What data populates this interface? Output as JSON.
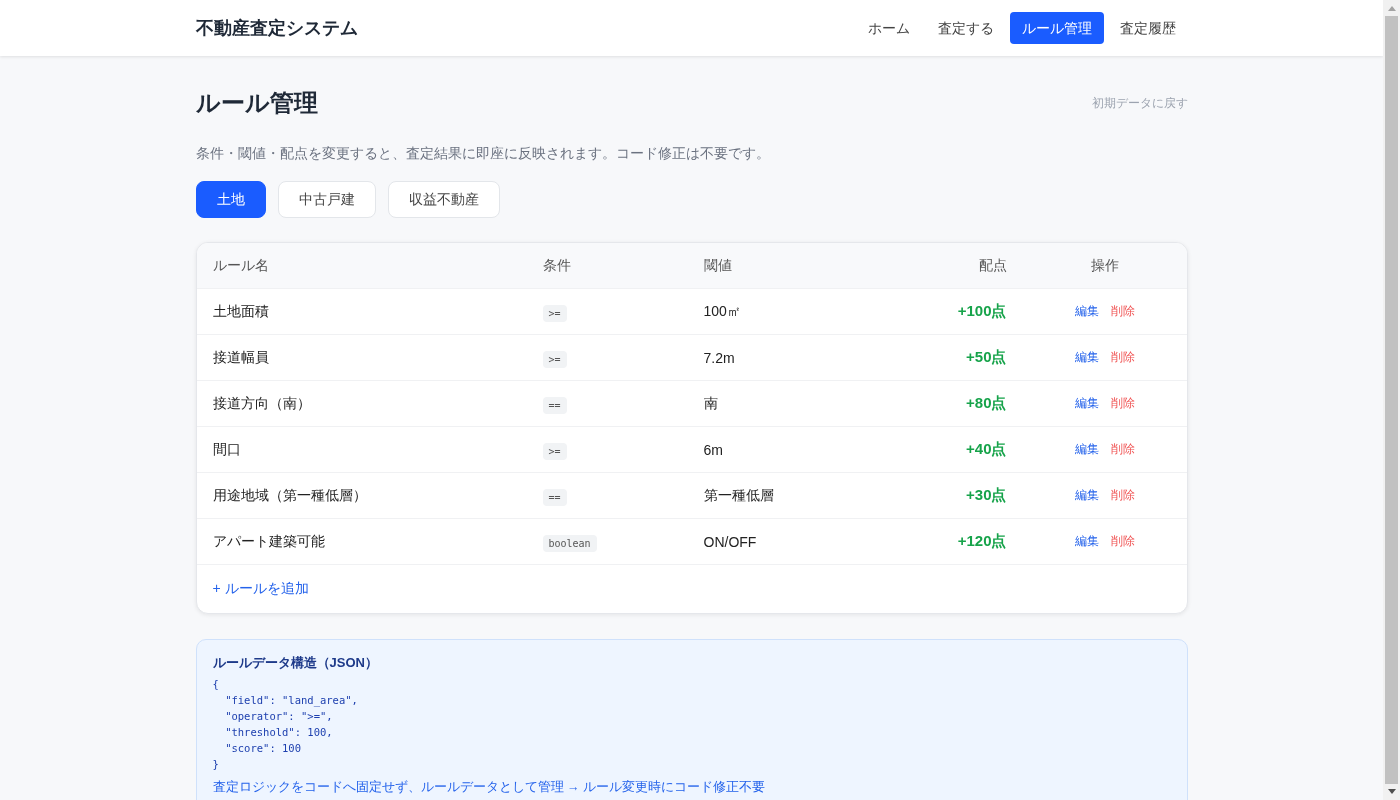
{
  "header": {
    "logo": "不動産査定システム",
    "nav": [
      {
        "label": "ホーム",
        "selected": false
      },
      {
        "label": "査定する",
        "selected": false
      },
      {
        "label": "ルール管理",
        "selected": true
      },
      {
        "label": "査定履歴",
        "selected": false
      }
    ]
  },
  "page": {
    "title": "ルール管理",
    "reset_link": "初期データに戻す",
    "description": "条件・閾値・配点を変更すると、査定結果に即座に反映されます。コード修正は不要です。"
  },
  "tabs": [
    {
      "label": "土地",
      "selected": true
    },
    {
      "label": "中古戸建",
      "selected": false
    },
    {
      "label": "収益不動産",
      "selected": false
    }
  ],
  "table": {
    "columns": [
      "ルール名",
      "条件",
      "閾値",
      "配点",
      "操作"
    ],
    "rows": [
      {
        "name": "土地面積",
        "condition": ">=",
        "threshold": "100㎡",
        "score": "+100点",
        "actions": [
          {
            "label": "編集",
            "kind": "edit"
          },
          {
            "label": "削除",
            "kind": "delete"
          }
        ]
      },
      {
        "name": "接道幅員",
        "condition": ">=",
        "threshold": "7.2m",
        "score": "+50点",
        "actions": [
          {
            "label": "編集",
            "kind": "edit"
          },
          {
            "label": "削除",
            "kind": "delete"
          }
        ]
      },
      {
        "name": "接道方向（南）",
        "condition": "==",
        "threshold": "南",
        "score": "+80点",
        "actions": [
          {
            "label": "編集",
            "kind": "edit"
          },
          {
            "label": "削除",
            "kind": "delete"
          }
        ]
      },
      {
        "name": "間口",
        "condition": ">=",
        "threshold": "6m",
        "score": "+40点",
        "actions": [
          {
            "label": "編集",
            "kind": "edit"
          },
          {
            "label": "削除",
            "kind": "delete"
          }
        ]
      },
      {
        "name": "用途地域（第一種低層）",
        "condition": "==",
        "threshold": "第一種低層",
        "score": "+30点",
        "actions": [
          {
            "label": "編集",
            "kind": "edit"
          },
          {
            "label": "削除",
            "kind": "delete"
          }
        ]
      },
      {
        "name": "アパート建築可能",
        "condition": "boolean",
        "threshold": "ON/OFF",
        "score": "+120点",
        "actions": [
          {
            "label": "編集",
            "kind": "edit"
          },
          {
            "label": "削除",
            "kind": "delete"
          }
        ]
      }
    ],
    "add_link": "+ ルールを追加"
  },
  "json_panel": {
    "title": "ルールデータ構造（JSON）",
    "code_lines": [
      "{",
      "  \"field\": \"land_area\",",
      "  \"operator\": \">=\",",
      "  \"threshold\": 100,",
      "  \"score\": 100",
      "}"
    ],
    "note": "査定ロジックをコードへ固定せず、ルールデータとして管理 → ルール変更時にコード修正不要"
  }
}
